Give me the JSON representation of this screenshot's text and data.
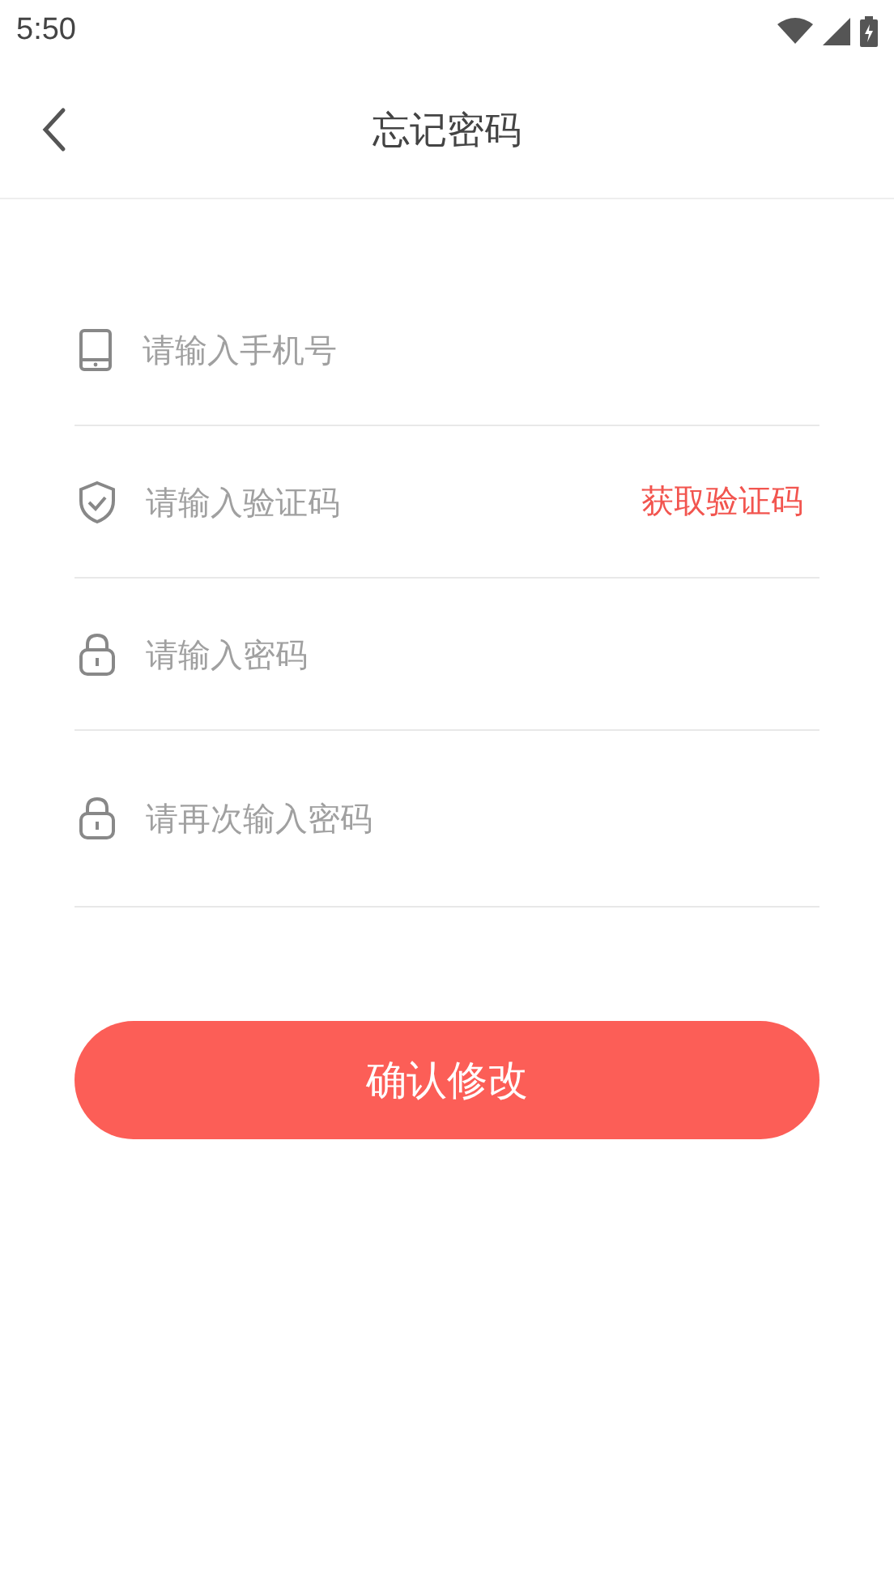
{
  "status_bar": {
    "time": "5:50"
  },
  "header": {
    "title": "忘记密码"
  },
  "fields": [
    {
      "kind": "phone",
      "placeholder": "请输入手机号"
    },
    {
      "kind": "code",
      "placeholder": "请输入验证码",
      "action": "获取验证码"
    },
    {
      "kind": "lock",
      "placeholder": "请输入密码"
    },
    {
      "kind": "lock",
      "placeholder": "请再次输入密码"
    }
  ],
  "submit_button": {
    "label": "确认修改"
  }
}
